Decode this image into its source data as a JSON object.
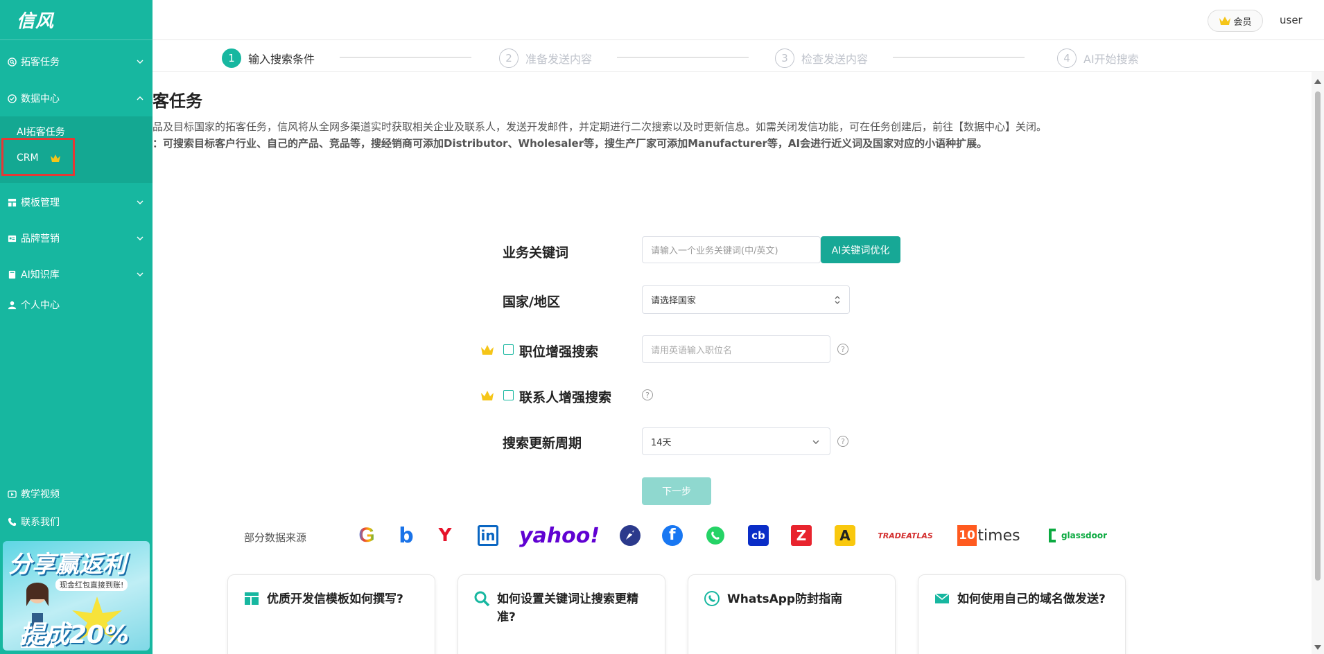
{
  "app": {
    "logo": "信风"
  },
  "colors": {
    "brand": "#17b7a0",
    "highlight_border": "#e53935",
    "gold": "#f5c518"
  },
  "sidebar": {
    "items": [
      {
        "label": "拓客任务",
        "icon": "search-circle-icon"
      },
      {
        "label": "数据中心",
        "icon": "check-circle-icon"
      },
      {
        "label": "模板管理",
        "icon": "layout-icon"
      },
      {
        "label": "品牌营销",
        "icon": "id-card-icon"
      },
      {
        "label": "AI知识库",
        "icon": "book-icon"
      },
      {
        "label": "个人中心",
        "icon": "user-icon"
      }
    ],
    "submenu": [
      {
        "label": "AI拓客任务"
      },
      {
        "label": "CRM"
      }
    ],
    "footer": [
      {
        "label": "教学视频",
        "icon": "video-icon"
      },
      {
        "label": "联系我们",
        "icon": "phone-icon"
      }
    ],
    "promo": {
      "title": "分享赢返利",
      "subtitle": "现金红包直接到账!",
      "tagline": "提成20%"
    }
  },
  "header": {
    "member_label": "会员",
    "user": "user"
  },
  "steps": [
    {
      "num": "1",
      "label": "输入搜索条件"
    },
    {
      "num": "2",
      "label": "准备发送内容"
    },
    {
      "num": "3",
      "label": "检查发送内容"
    },
    {
      "num": "4",
      "label": "AI开始搜索"
    }
  ],
  "page": {
    "title": "客任务",
    "desc_line1": "品及目标国家的拓客任务，信风将从全网多渠道实时获取相关企业及联系人，发送开发邮件，并定期进行二次搜索以及时更新信息。如需关闭发信功能，可在任务创建后，前往【数据中心】关闭。",
    "desc_line2": "：可搜索目标客户行业、自己的产品、竞品等，搜经销商可添加Distributor、Wholesaler等，搜生产厂家可添加Manufacturer等，AI会进行近义词及国家对应的小语种扩展。"
  },
  "form": {
    "keyword_label": "业务关键词",
    "keyword_placeholder": "请输入一个业务关键词(中/英文)",
    "ai_button": "AI关键词优化",
    "country_label": "国家/地区",
    "country_value": "请选择国家",
    "position_label": "职位增强搜索",
    "position_placeholder": "请用英语输入职位名",
    "contact_label": "联系人增强搜索",
    "cycle_label": "搜索更新周期",
    "cycle_value": "14天",
    "help_glyph": "?",
    "next_button": "下一步"
  },
  "sources": {
    "label": "部分数据来源",
    "items": [
      "G",
      "b",
      "Y",
      "in",
      "yahoo!",
      "rocket",
      "f",
      "whatsapp",
      "cb",
      "Z",
      "A",
      "TRADEATLAS",
      "10",
      "times",
      "glassdoor"
    ]
  },
  "cards": [
    {
      "title": "优质开发信模板如何撰写?",
      "icon": "template-icon"
    },
    {
      "title": "如何设置关键词让搜索更精准?",
      "icon": "search-icon"
    },
    {
      "title": "WhatsApp防封指南",
      "icon": "whatsapp-icon"
    },
    {
      "title": "如何使用自己的域名做发送?",
      "icon": "mail-icon"
    }
  ]
}
